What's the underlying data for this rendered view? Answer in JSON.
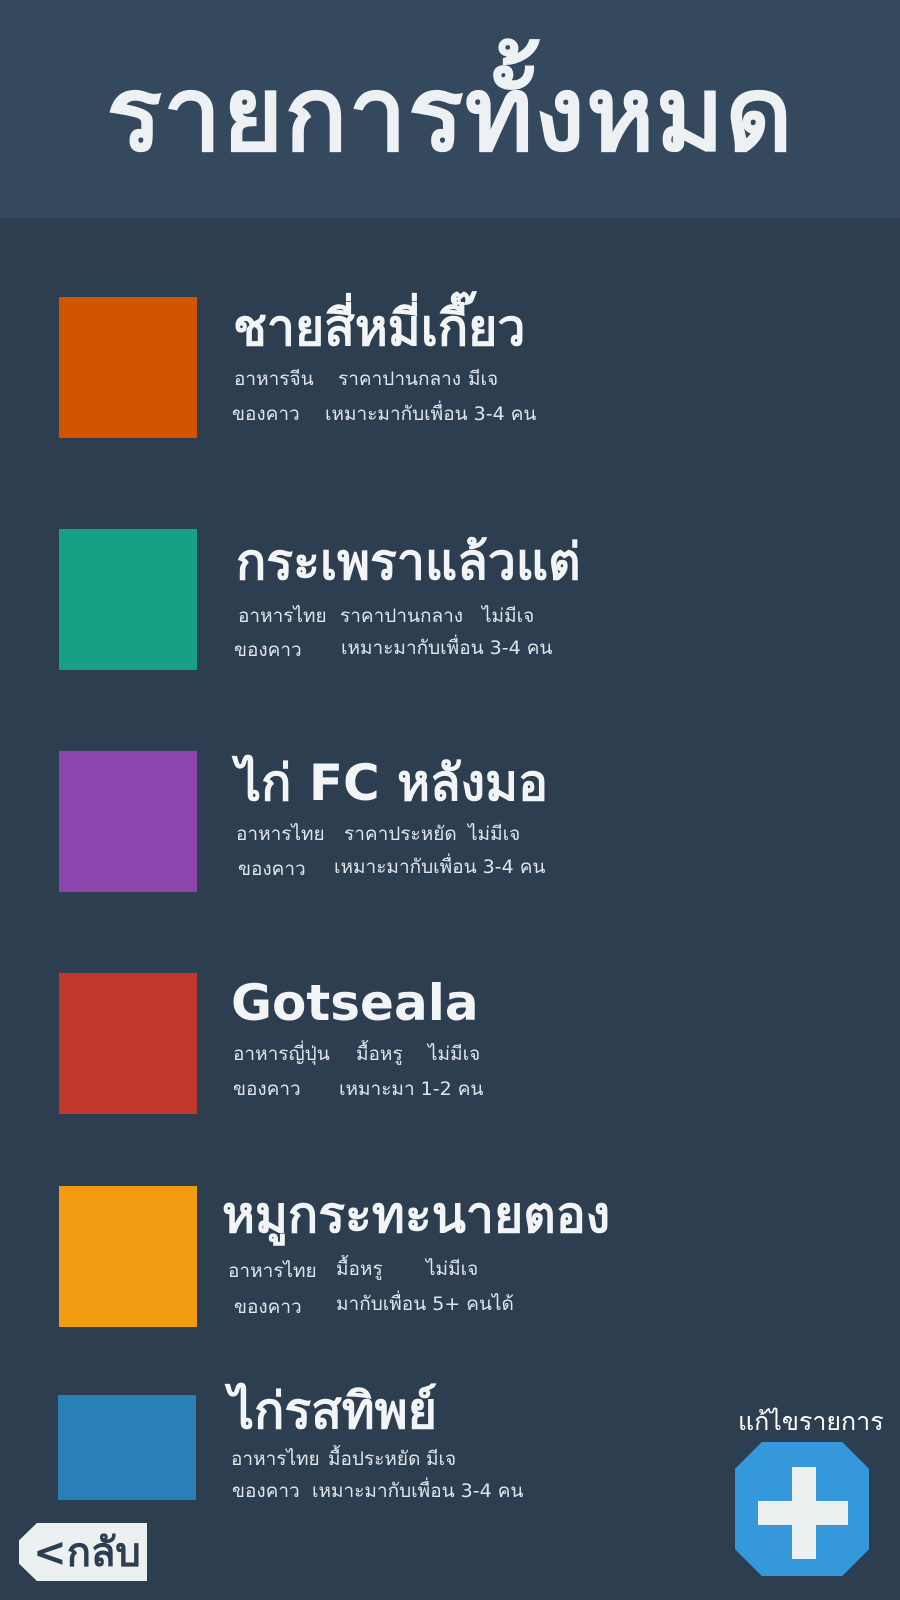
{
  "header": {
    "title": "รายการทั้งหมด",
    "background": "#34495e"
  },
  "page_background": "#2c3e50",
  "items": [
    {
      "name": "ชายสี่หมี่เกี๊ยว",
      "color": "#d35400",
      "tags_row1": [
        "อาหารจีน",
        "ราคาปานกลาง",
        "มีเจ"
      ],
      "tags_row2": [
        "ของคาว",
        "เหมาะมากับเพื่อน 3-4 คน"
      ]
    },
    {
      "name": "กระเพราแล้วแต่",
      "color": "#16a085",
      "tags_row1": [
        "อาหารไทย",
        "ราคาปานกลาง",
        "ไม่มีเจ"
      ],
      "tags_row2": [
        "ของคาว",
        "เหมาะมากับเพื่อน 3-4 คน"
      ]
    },
    {
      "name": "ไก่ FC หลังมอ",
      "color": "#8e44ad",
      "tags_row1": [
        "อาหารไทย",
        "ราคาประหยัด",
        "ไม่มีเจ"
      ],
      "tags_row2": [
        "ของคาว",
        "เหมาะมากับเพื่อน 3-4 คน"
      ]
    },
    {
      "name": "Gotseala",
      "color": "#c0392b",
      "tags_row1": [
        "อาหารญี่ปุ่น",
        "มื้อหรู",
        "ไม่มีเจ"
      ],
      "tags_row2": [
        "ของคาว",
        "เหมาะมา 1-2 คน"
      ]
    },
    {
      "name": "หมูกระทะนายตอง",
      "color": "#f39c12",
      "tags_row1": [
        "อาหารไทย",
        "มื้อหรู",
        "ไม่มีเจ"
      ],
      "tags_row2": [
        "ของคาว",
        "มากับเพื่อน 5+ คนได้"
      ]
    },
    {
      "name": "ไก่รสทิพย์",
      "color": "#2980b9",
      "tags_row1": [
        "อาหารไทย",
        "มื้อประหยัด",
        "มีเจ"
      ],
      "tags_row2": [
        "ของคาว",
        "เหมาะมากับเพื่อน 3-4 คน"
      ]
    }
  ],
  "actions": {
    "edit_label": "แก้ไขรายการ",
    "add_icon": "plus-icon",
    "add_color": "#3498db",
    "back_label": "<กลับ"
  }
}
